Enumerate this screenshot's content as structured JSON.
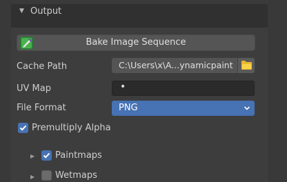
{
  "panel": {
    "title": "Output",
    "collapse_arrow": "triangle-down-icon"
  },
  "bake": {
    "label": "Bake Image Sequence",
    "icon": "bake-brush-icon"
  },
  "cache_path": {
    "label": "Cache Path",
    "value": "C:\\Users\\x\\A...ynamicpaint",
    "icon": "folder-icon"
  },
  "uv_map": {
    "label": "UV Map",
    "value": "•"
  },
  "file_format": {
    "label": "File Format",
    "value": "PNG"
  },
  "premultiply": {
    "label": "Premultiply Alpha",
    "checked": true
  },
  "outputs": [
    {
      "label": "Paintmaps",
      "checked": true
    },
    {
      "label": "Wetmaps",
      "checked": false
    }
  ],
  "colors": {
    "accent": "#4772b3",
    "panel_bg": "#3d3d3d",
    "header_bg": "#303030",
    "field_bg": "#545454"
  }
}
